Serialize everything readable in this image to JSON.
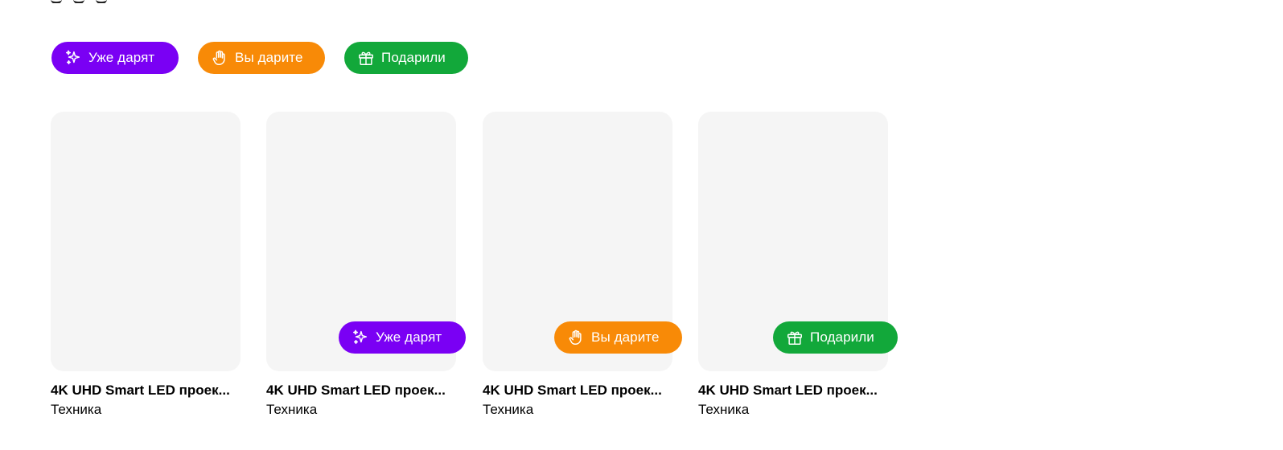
{
  "colors": {
    "purple": "#7a00f4",
    "orange": "#f88a07",
    "green": "#12a83a",
    "card_bg": "#f5f5f5"
  },
  "legend": {
    "gifting": {
      "label": "Уже дарят",
      "icon": "sparkles-icon"
    },
    "you_gift": {
      "label": "Вы дарите",
      "icon": "raised-hand-icon"
    },
    "gifted": {
      "label": "Подарили",
      "icon": "gift-icon"
    }
  },
  "cards": [
    {
      "title": "4K UHD Smart LED проек...",
      "category": "Техника",
      "status": null
    },
    {
      "title": "4K UHD Smart LED проек...",
      "category": "Техника",
      "status": "Уже дарят"
    },
    {
      "title": "4K UHD Smart LED проек...",
      "category": "Техника",
      "status": "Вы дарите"
    },
    {
      "title": "4K UHD Smart LED проек...",
      "category": "Техника",
      "status": "Подарили"
    }
  ]
}
